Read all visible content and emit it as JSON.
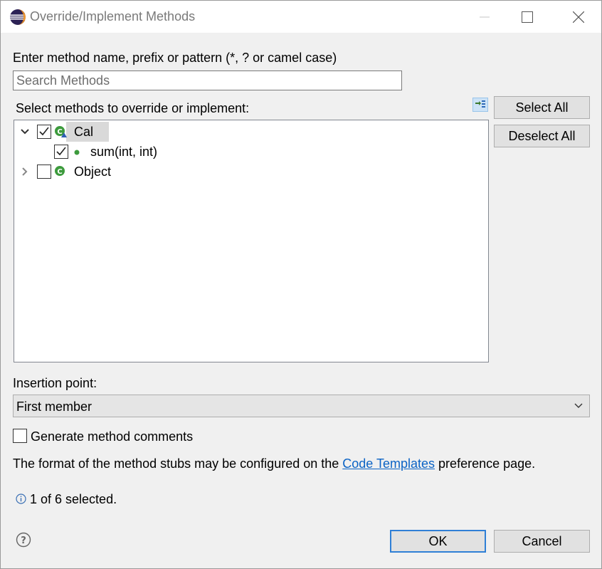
{
  "window": {
    "title": "Override/Implement Methods"
  },
  "filter": {
    "label": "Enter method name, prefix or pattern (*, ? or camel case)",
    "placeholder": "Search Methods",
    "value": ""
  },
  "methods": {
    "label": "Select methods to override or implement:",
    "tree": [
      {
        "label": "Cal",
        "checked": true,
        "expanded": true,
        "selected": true,
        "children": [
          {
            "label": "sum(int, int)",
            "checked": true
          }
        ]
      },
      {
        "label": "Object",
        "checked": false,
        "expanded": false
      }
    ]
  },
  "buttons": {
    "select_all": "Select All",
    "deselect_all": "Deselect All",
    "ok": "OK",
    "cancel": "Cancel"
  },
  "insertion": {
    "label": "Insertion point:",
    "selected": "First member"
  },
  "comments": {
    "label": "Generate method comments",
    "checked": false
  },
  "info": {
    "prefix": "The format of the method stubs may be configured on the",
    "link": "Code Templates",
    "suffix": "preference page."
  },
  "status": {
    "text": "1 of 6 selected."
  },
  "colors": {
    "accent": "#2f7fd6",
    "link": "#0b63c5",
    "dialog_bg": "#f0f0f0"
  }
}
